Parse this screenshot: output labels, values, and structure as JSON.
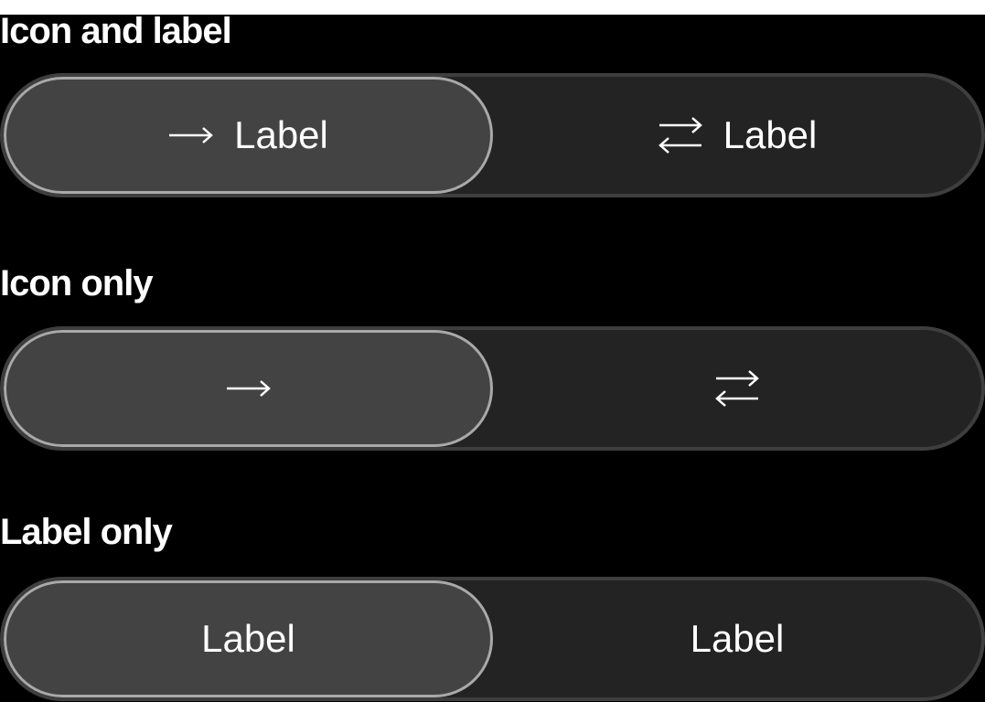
{
  "sections": [
    {
      "title": "Icon and label",
      "options": [
        {
          "label": "Label",
          "icon": "arrow-right-icon"
        },
        {
          "label": "Label",
          "icon": "swap-arrows-icon"
        }
      ]
    },
    {
      "title": "Icon only",
      "options": [
        {
          "icon": "arrow-right-icon"
        },
        {
          "icon": "swap-arrows-icon"
        }
      ]
    },
    {
      "title": "Label only",
      "options": [
        {
          "label": "Label"
        },
        {
          "label": "Label"
        }
      ]
    }
  ],
  "colors": {
    "selected_bg": "#434343",
    "selected_border": "#a9a9a9",
    "track_bg": "#232323",
    "track_border": "#3e3e3e",
    "text": "#ffffff"
  },
  "selected_index": 0
}
